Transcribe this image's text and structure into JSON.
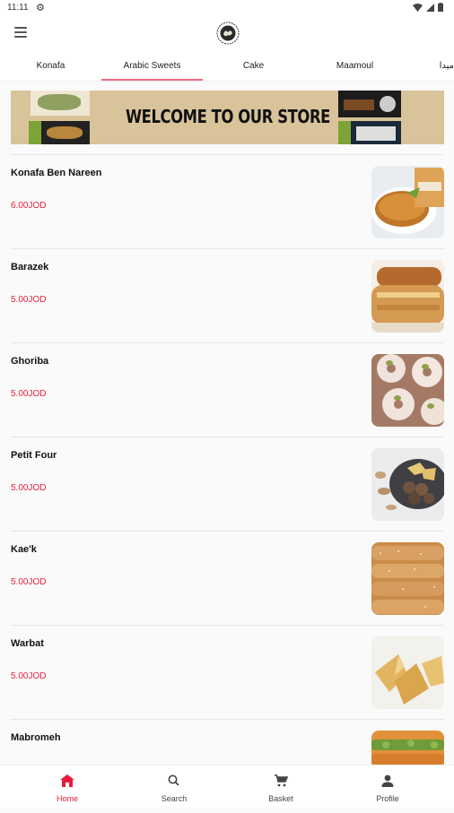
{
  "status": {
    "time": "11:11"
  },
  "tabs": [
    {
      "label": "Konafa"
    },
    {
      "label": "Arabic Sweets"
    },
    {
      "label": "Cake"
    },
    {
      "label": "Maamoul"
    },
    {
      "label": "ميدا"
    }
  ],
  "banner": {
    "title": "WELCOME TO OUR STORE"
  },
  "products": [
    {
      "name": "Konafa Ben Nareen",
      "price": "6.00JOD"
    },
    {
      "name": "Barazek",
      "price": "5.00JOD"
    },
    {
      "name": "Ghoriba",
      "price": "5.00JOD"
    },
    {
      "name": "Petit Four",
      "price": "5.00JOD"
    },
    {
      "name": "Kae'k",
      "price": "5.00JOD"
    },
    {
      "name": "Warbat",
      "price": "5.00JOD"
    },
    {
      "name": "Mabromeh",
      "price": ""
    }
  ],
  "nav": [
    {
      "label": "Home"
    },
    {
      "label": "Search"
    },
    {
      "label": "Basket"
    },
    {
      "label": "Profile"
    }
  ],
  "colors": {
    "accent": "#e51d3c",
    "tab_indicator": "#f06a80",
    "banner_bg": "#d9c39a"
  }
}
